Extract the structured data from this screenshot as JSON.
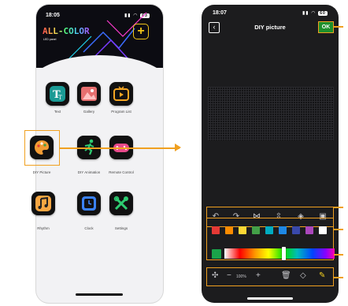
{
  "left_screen": {
    "status": {
      "time": "18:05",
      "battery": "63"
    },
    "brand": {
      "logo_text": "ALL-COLOR",
      "subtitle": "LED panel",
      "add_icon": "plus-square-icon"
    },
    "apps": [
      {
        "label": "Text",
        "icon": "text-icon"
      },
      {
        "label": "Gallery",
        "icon": "gallery-icon"
      },
      {
        "label": "Program List",
        "icon": "tv-icon"
      },
      {
        "label": "DIY Picture",
        "icon": "palette-icon",
        "highlighted": true
      },
      {
        "label": "DIY Animation",
        "icon": "running-figure-icon"
      },
      {
        "label": "Remote Control",
        "icon": "gamepad-icon"
      },
      {
        "label": "Rhythm",
        "icon": "music-note-icon"
      },
      {
        "label": "Clock",
        "icon": "clock-icon"
      },
      {
        "label": "Settings",
        "icon": "tools-icon"
      }
    ]
  },
  "right_screen": {
    "status": {
      "time": "18:07",
      "battery": "60"
    },
    "title": "DIY picture",
    "ok_label": "OK",
    "tools": [
      "undo-icon",
      "redo-icon",
      "mirror-icon",
      "flip-vertical-icon",
      "fill-icon",
      "image-import-icon"
    ],
    "palette": [
      "#e53935",
      "#fb8c00",
      "#fdd835",
      "#43a047",
      "#00acc1",
      "#1e88e5",
      "#3949ab",
      "#ab47bc",
      "#ffffff"
    ],
    "selected_color": "#1aa34a",
    "zoom": "100%",
    "bottom_tools": [
      "move-icon",
      "zoom-out-icon",
      "zoom-in-icon",
      "trash-icon",
      "eraser-icon",
      "pencil-icon"
    ]
  },
  "accent_color": "#f0a020"
}
